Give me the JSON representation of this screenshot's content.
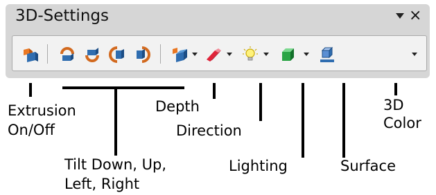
{
  "toolbar": {
    "title": "3D-Settings",
    "close_label": "×",
    "colors": {
      "panel": "#d6d6d6",
      "iconrow": "#f2f2f2"
    }
  },
  "icons": {
    "extrusion": "extrusion-icon",
    "tilt_down": "tilt-down-icon",
    "tilt_up": "tilt-up-icon",
    "tilt_left": "tilt-left-icon",
    "tilt_right": "tilt-right-icon",
    "depth": "depth-icon",
    "direction": "direction-icon",
    "lighting": "lightbulb-icon",
    "surface": "surface-icon",
    "color": "3d-color-icon"
  },
  "callouts": {
    "extrusion_1": "Extrusion",
    "extrusion_2": "On/Off",
    "tilt_1": "Tilt Down, Up,",
    "tilt_2": "Left, Right",
    "depth": "Depth",
    "direction": "Direction",
    "lighting": "Lighting",
    "surface": "Surface",
    "color_1": "3D",
    "color_2": "Color"
  }
}
